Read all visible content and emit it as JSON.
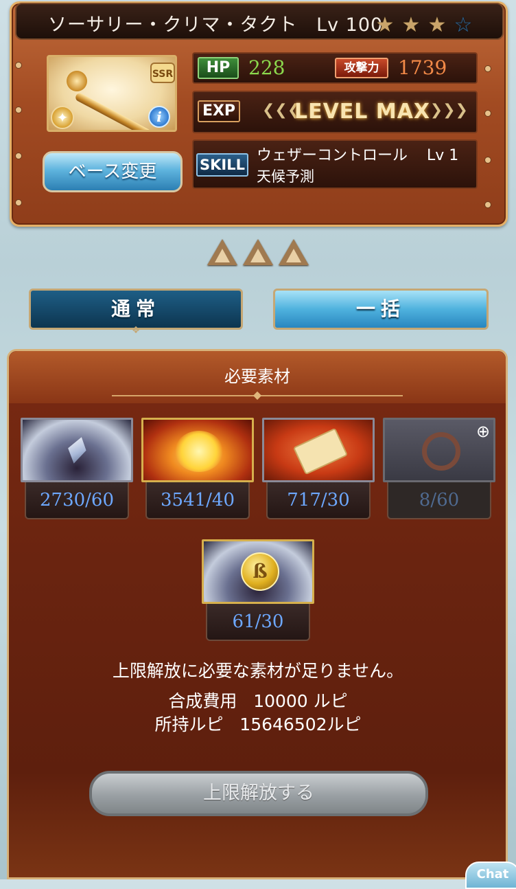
{
  "item": {
    "name_title": "ソーサリー・クリマ・タクト",
    "level_label": "Lv 100",
    "stars": [
      {
        "state": "filled",
        "icon": "star-icon"
      },
      {
        "state": "filled",
        "icon": "star-icon"
      },
      {
        "state": "filled",
        "icon": "star-icon"
      },
      {
        "state": "empty",
        "icon": "star-icon"
      }
    ],
    "rarity": "SSR",
    "hp_label": "HP",
    "hp_value": "228",
    "atk_label": "攻撃力",
    "atk_value": "1739",
    "exp_label": "EXP",
    "exp_status": "LEVEL MAX",
    "skill_label": "SKILL",
    "skill_name": "ウェザーコントロール",
    "skill_level": "Lv 1",
    "skill_desc": "天候予測",
    "base_change_label": "ベース変更",
    "uncap_level": 3
  },
  "mode": {
    "normal_label": "通常",
    "bulk_label": "一括",
    "selected": "bulk"
  },
  "materials": {
    "title": "必要素材",
    "list": [
      {
        "count": "2730/60",
        "icon": "crystal-icon",
        "sufficient": true
      },
      {
        "count": "3541/40",
        "icon": "flame-burst-icon",
        "sufficient": true
      },
      {
        "count": "717/30",
        "icon": "scroll-icon",
        "sufficient": true
      },
      {
        "count": "8/60",
        "icon": "ship-wheel-icon",
        "sufficient": false
      }
    ],
    "extra": {
      "count": "61/30",
      "icon": "coin-icon",
      "sufficient": true
    }
  },
  "footer": {
    "insufficient_msg": "上限解放に必要な素材が足りません。",
    "fee_label": "合成費用",
    "fee_value": "10000 ルピ",
    "owned_label": "所持ルピ",
    "owned_value": "15646502ルピ",
    "uncap_button_label": "上限解放する",
    "chat_label": "Chat"
  },
  "colors": {
    "hp": "#8bd84d",
    "atk": "#f38a48",
    "count": "#6da8ff",
    "panel": "#a24b22"
  }
}
